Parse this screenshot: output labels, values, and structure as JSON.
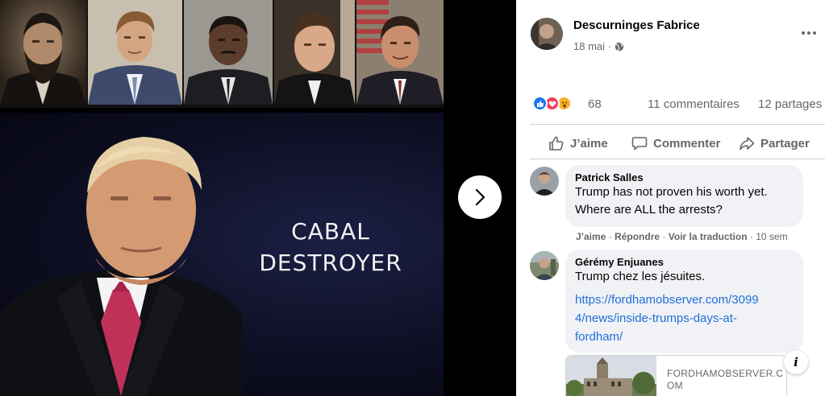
{
  "post": {
    "author": "Descurninges Fabrice",
    "date": "18 mai",
    "meta_separator": "·",
    "privacy_icon": "globe-icon"
  },
  "image": {
    "caption_line1": "CABAL",
    "caption_line2": "DESTROYER"
  },
  "reactions": {
    "icons": [
      "like-icon",
      "love-icon",
      "wow-icon"
    ],
    "count": "68",
    "comments": "11 commentaires",
    "shares": "12 partages"
  },
  "actions": {
    "like": "J’aime",
    "comment": "Commenter",
    "share": "Partager"
  },
  "comments": [
    {
      "name": "Patrick Salles",
      "text_line1": "Trump has not proven his worth yet.",
      "text_line2": "Where are ALL the arrests?",
      "like": "J’aime",
      "reply": "Répondre",
      "translate": "Voir la traduction",
      "sep": "·",
      "time": "10 sem"
    },
    {
      "name": "Gérémy Enjuanes",
      "text": "Trump chez les jésuites.",
      "link_line1": "https://fordhamobserver.com/3099",
      "link_line2": "4/news/inside-trumps-days-at-",
      "link_line3": "fordham/",
      "preview_domain_line1": "FORDHAMOBSERVER.C",
      "preview_domain_line2": "OM"
    }
  ],
  "colors": {
    "like_blue": "#1877f2",
    "love_red": "#f33e58",
    "wow_yellow": "#f7b125",
    "link_blue": "#216fdb",
    "meta_gray": "#65676b",
    "bubble_bg": "#f0f2f5"
  }
}
